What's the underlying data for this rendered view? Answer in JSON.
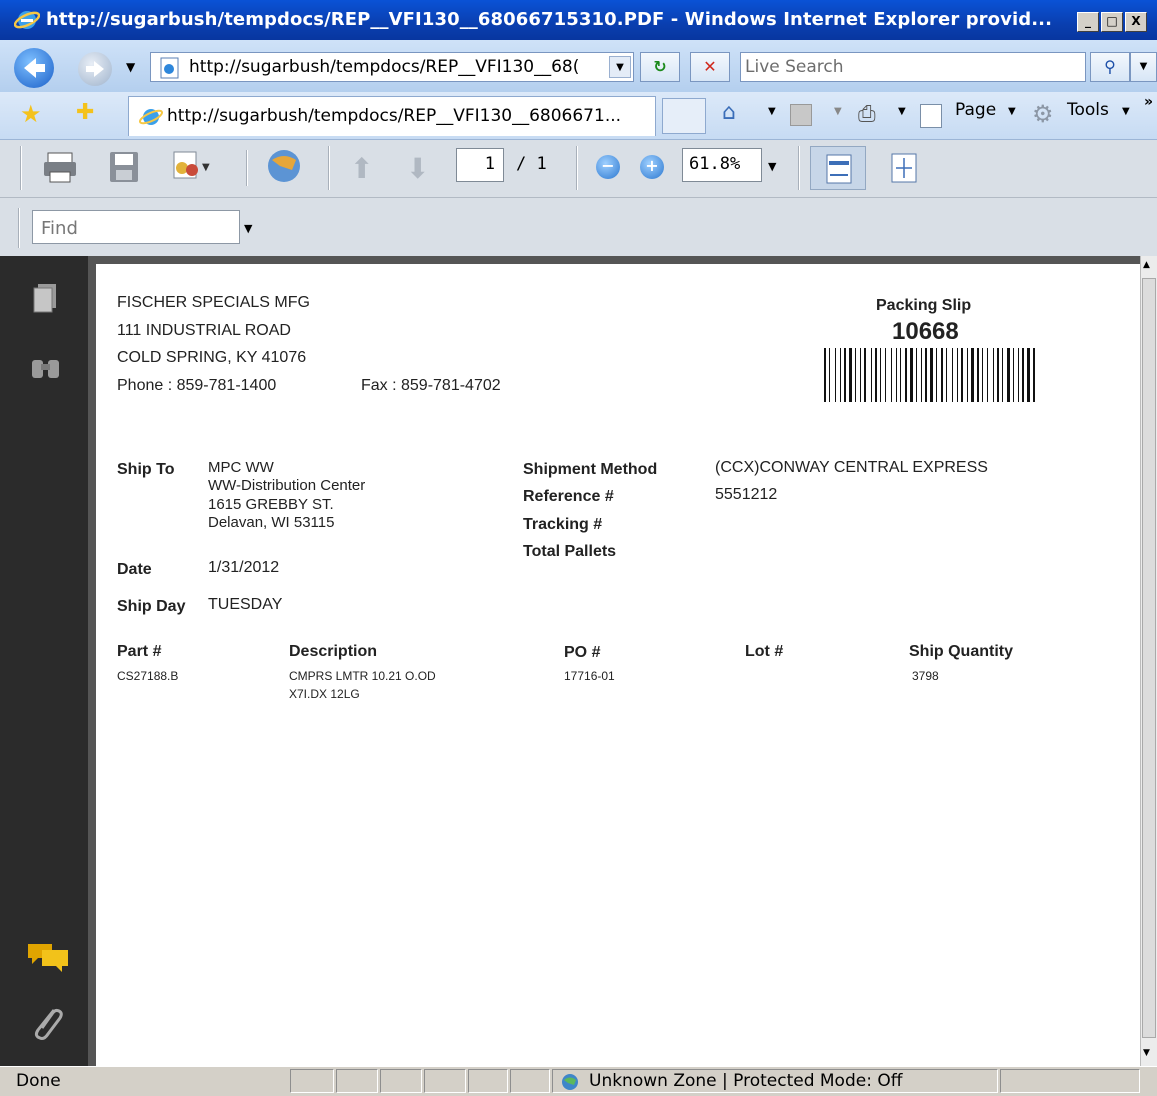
{
  "window": {
    "title": "http://sugarbush/tempdocs/REP__VFI130__68066715310.PDF - Windows Internet Explorer provid...",
    "minimize": "_",
    "maximize": "□",
    "close": "X"
  },
  "address_bar": {
    "url": "http://sugarbush/tempdocs/REP__VFI130__68(",
    "search_placeholder": "Live Search"
  },
  "tab": {
    "title": "http://sugarbush/tempdocs/REP__VFI130__6806671..."
  },
  "command_bar": {
    "page_label": "Page",
    "tools_label": "Tools",
    "more": "»"
  },
  "pdf_toolbar": {
    "current_page": "1",
    "page_total": "/ 1",
    "zoom": "61.8%"
  },
  "find_bar": {
    "placeholder": "Find"
  },
  "document": {
    "company": {
      "name": "FISCHER SPECIALS MFG",
      "address1": "111 INDUSTRIAL ROAD",
      "address2": "COLD SPRING, KY 41076",
      "phone": "Phone : 859-781-1400",
      "fax": "Fax : 859-781-4702"
    },
    "slip_label": "Packing Slip",
    "slip_number": "10668",
    "ship_to_label": "Ship To",
    "ship_to": [
      "MPC WW",
      "WW-Distribution Center",
      "1615 GREBBY ST.",
      "Delavan, WI 53115"
    ],
    "date_label": "Date",
    "date": "1/31/2012",
    "ship_day_label": "Ship Day",
    "ship_day": "TUESDAY",
    "shipment_method_label": "Shipment Method",
    "shipment_method": "(CCX)CONWAY CENTRAL EXPRESS",
    "reference_label": "Reference #",
    "reference": "5551212",
    "tracking_label": "Tracking #",
    "total_pallets_label": "Total Pallets",
    "table": {
      "headers": [
        "Part #",
        "Description",
        "PO #",
        "Lot #",
        "Ship Quantity"
      ],
      "rows": [
        {
          "part": "CS27188.B",
          "description": [
            "CMPRS LMTR 10.21 O.OD",
            "X7I.DX 12LG"
          ],
          "po": "17716-01",
          "lot": "",
          "qty": "3798"
        }
      ]
    }
  },
  "status_bar": {
    "text": "Done",
    "zone": "Unknown Zone | Protected Mode: Off"
  }
}
